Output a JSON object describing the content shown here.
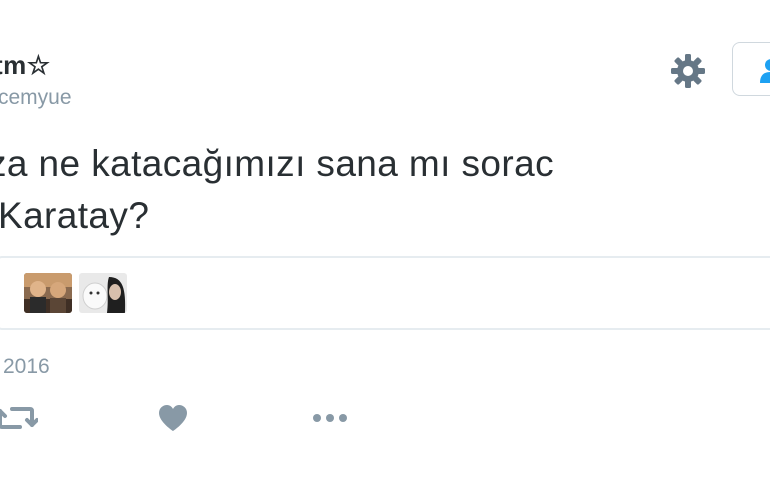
{
  "user": {
    "display_name": "tm☆",
    "handle": "cemyue"
  },
  "tweet": {
    "line1": "za ne katacağımızı sana mı sorac",
    "line2": "Karatay?",
    "timestamp": "2016"
  },
  "icons": {
    "settings": "gear-icon",
    "follow": "follow-person-icon",
    "retweet": "retweet-icon",
    "like": "heart-icon",
    "more": "more-dots-icon"
  },
  "colors": {
    "text": "#292f33",
    "secondary": "#8899a6",
    "icon": "#657786",
    "follow_accent": "#1da1f2",
    "border": "#e6ecf0"
  }
}
